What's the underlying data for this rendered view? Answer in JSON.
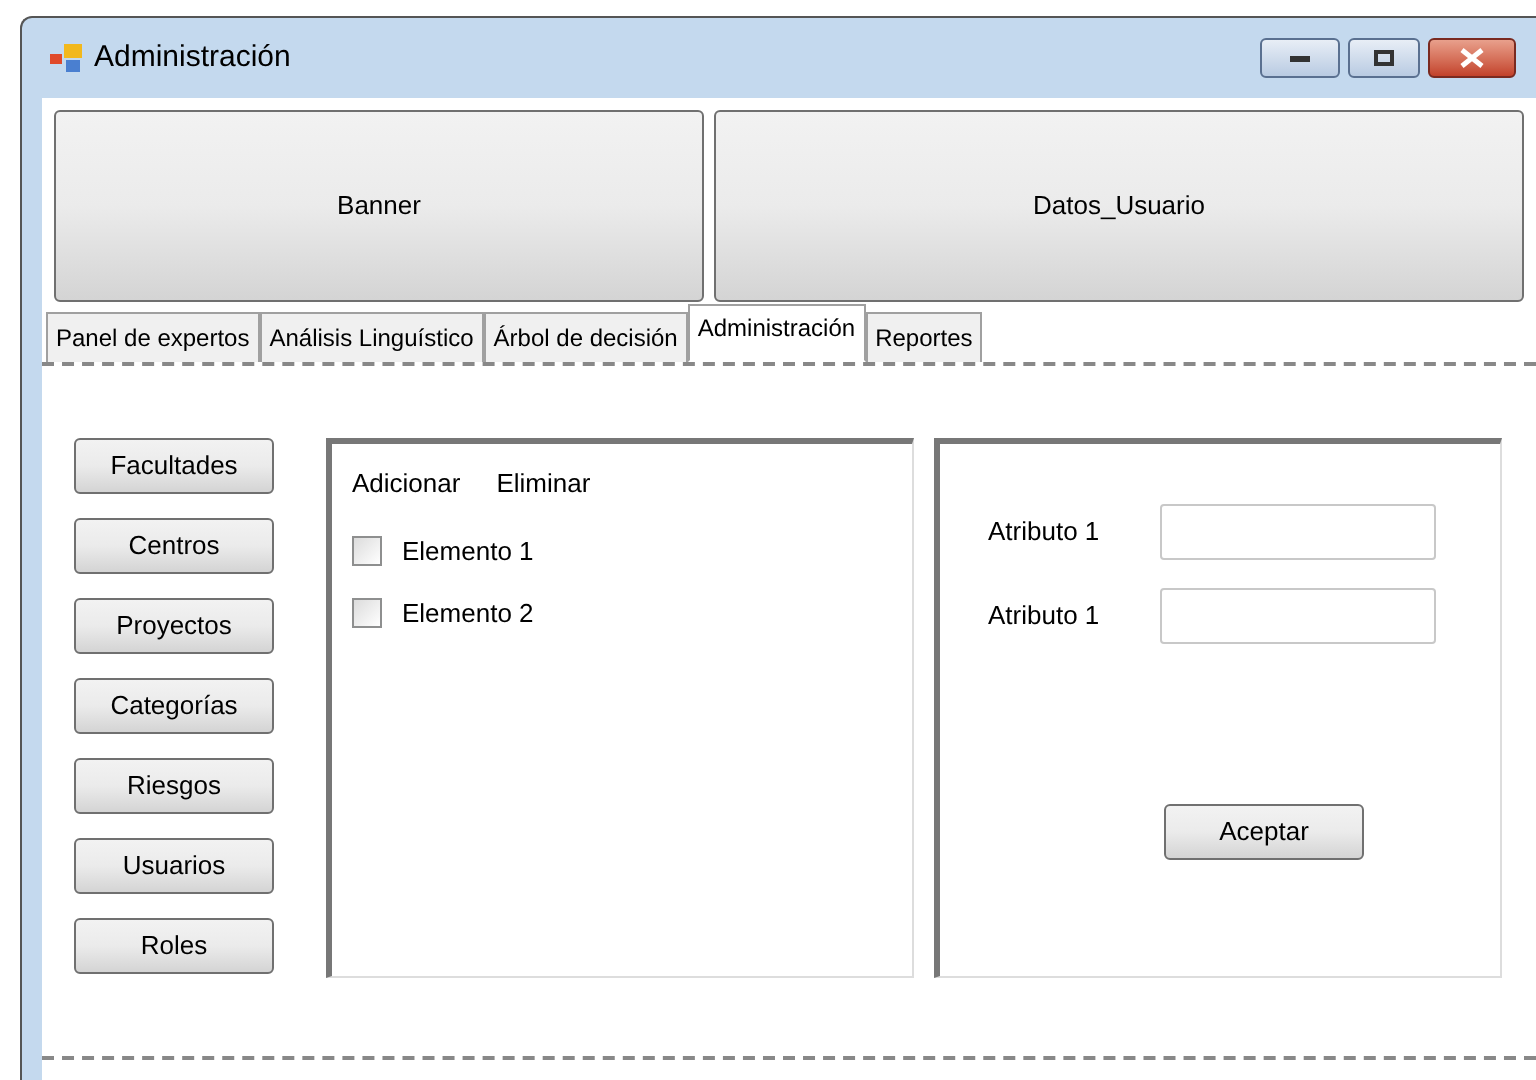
{
  "window": {
    "title": "Administración"
  },
  "top_buttons": [
    "Banner",
    "Datos_Usuario"
  ],
  "tabs": [
    {
      "label": "Panel de expertos",
      "selected": false
    },
    {
      "label": "Análisis Linguístico",
      "selected": false
    },
    {
      "label": "Árbol de decisión",
      "selected": false
    },
    {
      "label": "Administración",
      "selected": true
    },
    {
      "label": "Reportes",
      "selected": false
    }
  ],
  "side_buttons": [
    "Facultades",
    "Centros",
    "Proyectos",
    "Categorías",
    "Riesgos",
    "Usuarios",
    "Roles"
  ],
  "list_panel": {
    "actions": [
      "Adicionar",
      "Eliminar"
    ],
    "items": [
      {
        "label": "Elemento 1",
        "checked": false
      },
      {
        "label": "Elemento 2",
        "checked": false
      }
    ]
  },
  "form_panel": {
    "fields": [
      {
        "label": "Atributo 1"
      },
      {
        "label": "Atributo 1"
      }
    ],
    "button": "Aceptar"
  }
}
